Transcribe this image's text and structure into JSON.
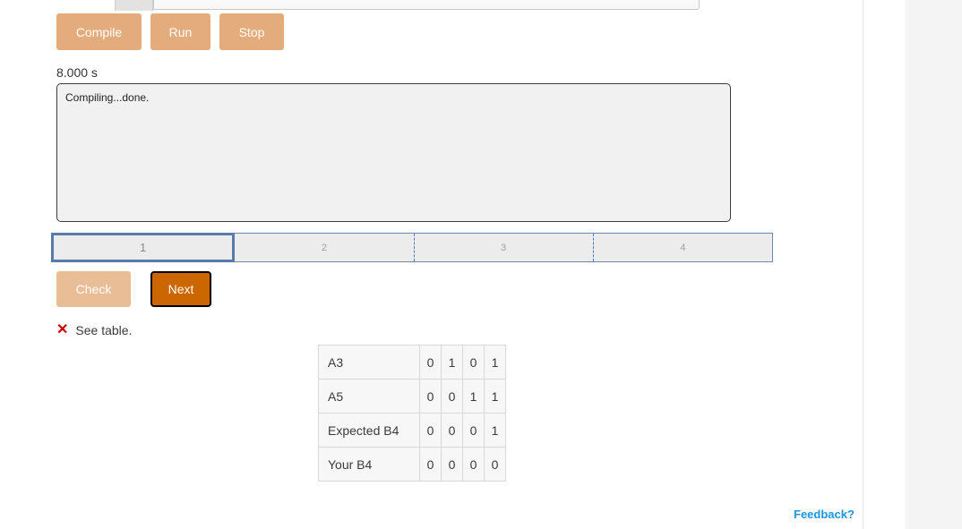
{
  "top_bar": {
    "tab_label": "",
    "address_value": "",
    "address_placeholder": ""
  },
  "toolbar": {
    "compile_label": "Compile",
    "run_label": "Run",
    "stop_label": "Stop"
  },
  "status": {
    "elapsed_time": "8.000 s"
  },
  "console": {
    "output": "Compiling...done.",
    "placeholder": ""
  },
  "steps": {
    "active_index": 0,
    "items": [
      {
        "label": "1"
      },
      {
        "label": "2"
      },
      {
        "label": "3"
      },
      {
        "label": "4"
      }
    ]
  },
  "answer_controls": {
    "check_label": "Check",
    "next_label": "Next"
  },
  "result": {
    "icon": "✕",
    "icon_name": "cross-icon",
    "message": "See table."
  },
  "truth_table": {
    "rows": [
      {
        "label": "A3",
        "bits": [
          "0",
          "1",
          "0",
          "1"
        ]
      },
      {
        "label": "A5",
        "bits": [
          "0",
          "0",
          "1",
          "1"
        ]
      },
      {
        "label": "Expected B4",
        "bits": [
          "0",
          "0",
          "0",
          "1"
        ]
      },
      {
        "label": "Your B4",
        "bits": [
          "0",
          "0",
          "0",
          "0"
        ]
      }
    ]
  },
  "footer": {
    "feedback_label": "Feedback?"
  },
  "colors": {
    "button_tan": "#e4ac7c",
    "button_tan_disabled": "#e9bd95",
    "button_next_orange": "#cc6600",
    "step_border_blue": "#5a7aa8",
    "step_divider_blue": "#4a78c0",
    "error_red": "#cc0000",
    "link_blue": "#1b95e0",
    "console_bg": "#f1f1f1",
    "rail_grey": "#f4f4f4"
  }
}
